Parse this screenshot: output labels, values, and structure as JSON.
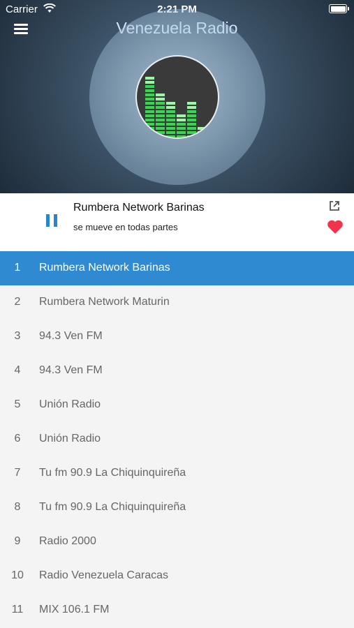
{
  "status_bar": {
    "carrier": "Carrier",
    "time": "2:21 PM"
  },
  "header": {
    "title": "Venezuela Radio",
    "menu_icon": "hamburger-menu-icon",
    "artwork_icon": "equalizer-icon"
  },
  "now_playing": {
    "title": "Rumbera Network Barinas",
    "subtitle": "se mueve en todas partes",
    "play_state_icon": "pause-icon",
    "share_icon": "share-icon",
    "favorite_icon": "heart-icon",
    "favorite_color": "#f2334d"
  },
  "colors": {
    "accent": "#2f8ad2",
    "pause": "#2a86c9"
  },
  "stations": [
    {
      "num": "1",
      "name": "Rumbera Network Barinas",
      "active": true
    },
    {
      "num": "2",
      "name": "Rumbera Network Maturin",
      "active": false
    },
    {
      "num": "3",
      "name": "94.3 Ven FM",
      "active": false
    },
    {
      "num": "4",
      "name": "94.3 Ven FM",
      "active": false
    },
    {
      "num": "5",
      "name": "Unión Radio",
      "active": false
    },
    {
      "num": "6",
      "name": "Unión Radio",
      "active": false
    },
    {
      "num": "7",
      "name": "Tu fm 90.9 La Chiquinquireña",
      "active": false
    },
    {
      "num": "8",
      "name": "Tu fm 90.9 La Chiquinquireña",
      "active": false
    },
    {
      "num": "9",
      "name": "Radio 2000",
      "active": false
    },
    {
      "num": "10",
      "name": "Radio Venezuela Caracas",
      "active": false
    },
    {
      "num": "11",
      "name": "MIX 106.1 FM",
      "active": false
    }
  ]
}
